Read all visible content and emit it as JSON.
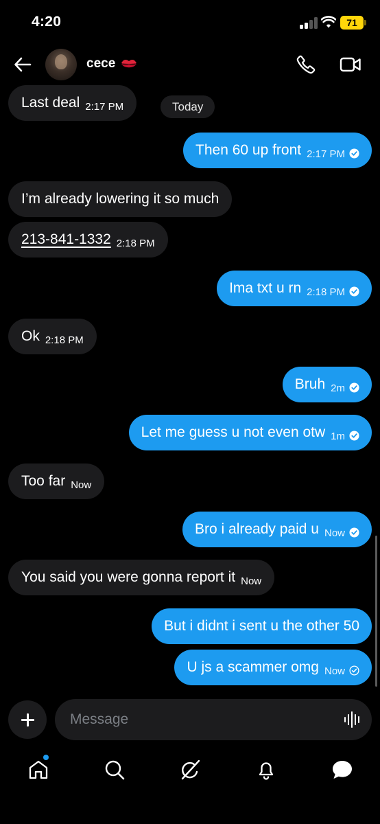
{
  "status_bar": {
    "time": "4:20",
    "battery": "71"
  },
  "header": {
    "contact_name": "cece"
  },
  "date_divider": "Today",
  "messages": [
    {
      "dir": "in",
      "text": "Last deal",
      "time": "2:17 PM"
    },
    {
      "dir": "out",
      "text": "Then 60 up front",
      "time": "2:17 PM"
    },
    {
      "dir": "in",
      "text": "I’m already lowering it so much",
      "time": ""
    },
    {
      "dir": "in",
      "text": "213-841-1332",
      "time": "2:18 PM"
    },
    {
      "dir": "out",
      "text": "Ima txt u rn",
      "time": "2:18 PM"
    },
    {
      "dir": "in",
      "text": "Ok",
      "time": "2:18 PM"
    },
    {
      "dir": "out",
      "text": "Bruh",
      "time": "2m"
    },
    {
      "dir": "out",
      "text": "Let me guess u not even otw",
      "time": "1m"
    },
    {
      "dir": "in",
      "text": "Too far",
      "time": "Now"
    },
    {
      "dir": "out",
      "text": "Bro i already paid u",
      "time": "Now"
    },
    {
      "dir": "in",
      "text": "You said you were gonna report it",
      "time": "Now"
    },
    {
      "dir": "out",
      "text": "But i didnt i sent u the other 50",
      "time": ""
    },
    {
      "dir": "out",
      "text": "U js a scammer omg",
      "time": "Now"
    }
  ],
  "composer": {
    "placeholder": "Message"
  },
  "colors": {
    "accent": "#1d9bf0",
    "incoming_bubble": "#1c1c1e",
    "background": "#000000"
  },
  "tabs": [
    "home-icon",
    "search-icon",
    "grok-icon",
    "notifications-icon",
    "messages-icon"
  ]
}
